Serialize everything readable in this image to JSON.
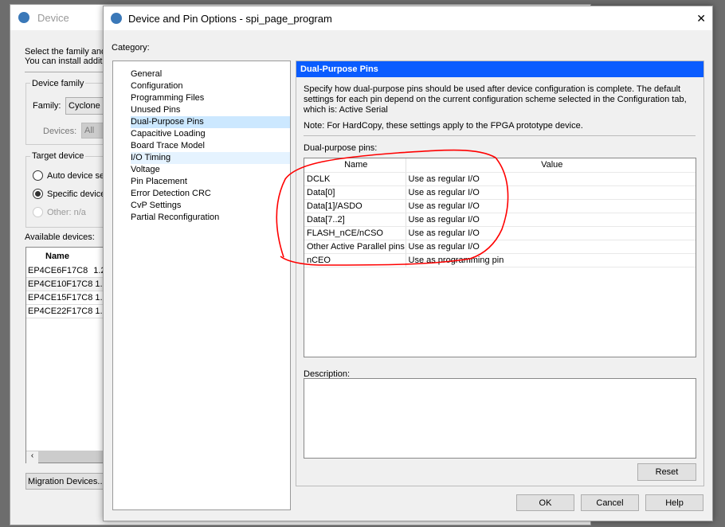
{
  "device_window": {
    "title": "Device",
    "intro_line1": "Select the family and",
    "intro_line2": "You can install additi",
    "device_family_label": "Device family",
    "family_label": "Family:",
    "family_value": "Cyclone I",
    "devices_label": "Devices:",
    "devices_value": "All",
    "target_device_label": "Target device",
    "radio_auto": "Auto device se",
    "radio_specific": "Specific device",
    "radio_other": "Other:  n/a",
    "available_devices_label": "Available devices:",
    "table_header_name": "Name",
    "devices": [
      {
        "name": "EP4CE6F17C8",
        "v": "1.2"
      },
      {
        "name": "EP4CE10F17C8",
        "v": "1.2"
      },
      {
        "name": "EP4CE15F17C8",
        "v": "1.2"
      },
      {
        "name": "EP4CE22F17C8",
        "v": "1.2"
      }
    ],
    "migration_button": "Migration Devices..."
  },
  "dialog": {
    "title": "Device and Pin Options - spi_page_program",
    "close": "✕",
    "category_label": "Category:",
    "categories": [
      "General",
      "Configuration",
      "Programming Files",
      "Unused Pins",
      "Dual-Purpose Pins",
      "Capacitive Loading",
      "Board Trace Model",
      "I/O Timing",
      "Voltage",
      "Pin Placement",
      "Error Detection CRC",
      "CvP Settings",
      "Partial Reconfiguration"
    ],
    "selected_category": "Dual-Purpose Pins",
    "panel": {
      "header": "Dual-Purpose Pins",
      "description": "Specify how dual-purpose pins should be used after device configuration is complete. The default settings for each pin depend on the current configuration scheme selected in the Configuration tab, which is:  Active Serial",
      "note": "Note: For HardCopy, these settings apply to the FPGA prototype device.",
      "pins_label": "Dual-purpose pins:",
      "col_name": "Name",
      "col_value": "Value",
      "rows": [
        {
          "name": "DCLK",
          "value": "Use as regular I/O"
        },
        {
          "name": "Data[0]",
          "value": "Use as regular I/O"
        },
        {
          "name": "Data[1]/ASDO",
          "value": "Use as regular I/O"
        },
        {
          "name": "Data[7..2]",
          "value": "Use as regular I/O"
        },
        {
          "name": "FLASH_nCE/nCSO",
          "value": "Use as regular I/O"
        },
        {
          "name": "Other Active Parallel pins",
          "value": "Use as regular I/O"
        },
        {
          "name": "nCEO",
          "value": "Use as programming pin"
        }
      ],
      "description_label": "Description:",
      "reset": "Reset"
    },
    "ok": "OK",
    "cancel": "Cancel",
    "help": "Help"
  },
  "colors": {
    "header_blue": "#0a5cff",
    "selected": "#cce8ff",
    "annotation": "#ff0000"
  }
}
